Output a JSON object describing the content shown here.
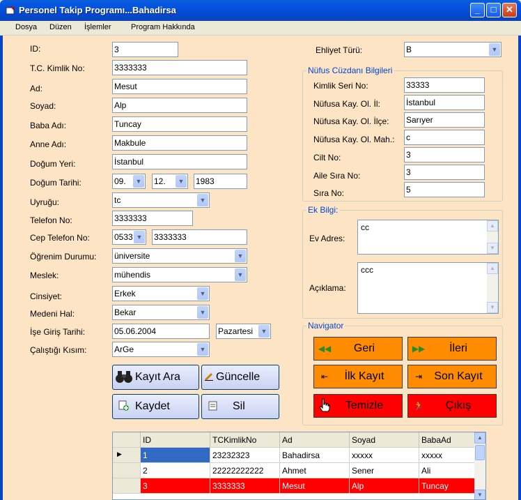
{
  "window": {
    "title": "Personel Takip Programı...Bahadirsa",
    "minimize": "_",
    "maximize": "□",
    "close": "✕"
  },
  "menu": [
    "Dosya",
    "Düzen",
    "İşlemler",
    "Program Hakkında"
  ],
  "form": {
    "id": {
      "label": "ID:",
      "value": "3"
    },
    "tc": {
      "label": "T.C. Kimlik No:",
      "value": "3333333"
    },
    "ad": {
      "label": "Ad:",
      "value": "Mesut"
    },
    "soyad": {
      "label": "Soyad:",
      "value": "Alp"
    },
    "baba": {
      "label": "Baba Adı:",
      "value": "Tuncay"
    },
    "anne": {
      "label": "Anne Adı:",
      "value": "Makbule"
    },
    "dogum_yeri": {
      "label": "Doğum Yeri:",
      "value": "İstanbul"
    },
    "dogum_tarihi": {
      "label": "Doğum Tarihi:",
      "day": "09.",
      "month": "12.",
      "year": "1983"
    },
    "uyruk": {
      "label": "Uyruğu:",
      "value": "tc"
    },
    "telefon": {
      "label": "Telefon No:",
      "value": "3333333"
    },
    "cep": {
      "label": "Cep Telefon No:",
      "prefix": "0533",
      "value": "3333333"
    },
    "ogrenim": {
      "label": "Öğrenim Durumu:",
      "value": "üniversite"
    },
    "meslek": {
      "label": "Meslek:",
      "value": "mühendis"
    },
    "cinsiyet": {
      "label": "Cinsiyet:",
      "value": "Erkek"
    },
    "medeni": {
      "label": "Medeni Hal:",
      "value": "Bekar"
    },
    "ise_giris": {
      "label": "İşe Giriş Tarihi:",
      "value": "05.06.2004",
      "weekday": "Pazartesi"
    },
    "kisim": {
      "label": "Çalıştığı Kısım:",
      "value": "ArGe"
    }
  },
  "ehliyet": {
    "label": "Ehliyet Türü:",
    "value": "B"
  },
  "nufus": {
    "title": "Nüfus Cüzdanı Bilgileri",
    "seri": {
      "label": "Kimlik Seri No:",
      "value": "33333"
    },
    "il": {
      "label": "Nüfusa Kay. Ol. İl:",
      "value": "İstanbul"
    },
    "ilce": {
      "label": "Nüfusa Kay. Ol. İlçe:",
      "value": "Sarıyer"
    },
    "mah": {
      "label": "Nüfusa Kay. Ol. Mah.:",
      "value": "c"
    },
    "cilt": {
      "label": "Cilt No:",
      "value": "3"
    },
    "aile": {
      "label": "Aile Sıra No:",
      "value": "3"
    },
    "sira": {
      "label": "Sıra No:",
      "value": "5"
    }
  },
  "ek": {
    "title": "Ek Bilgi:",
    "adres": {
      "label": "Ev Adres:",
      "value": "cc"
    },
    "aciklama": {
      "label": "Açıklama:",
      "value": "ccc"
    }
  },
  "actions": {
    "kayit_ara": "Kayıt Ara",
    "guncelle": "Güncelle",
    "kaydet": "Kaydet",
    "sil": "Sil"
  },
  "navigator": {
    "title": "Navigator",
    "geri": "Geri",
    "ileri": "İleri",
    "ilk": "İlk Kayıt",
    "son": "Son Kayıt",
    "temizle": "Temizle",
    "cikis": "Çıkış"
  },
  "grid": {
    "columns": [
      "ID",
      "TCKimlikNo",
      "Ad",
      "Soyad",
      "BabaAd"
    ],
    "rows": [
      [
        "1",
        "23232323",
        "Bahadirsa",
        "xxxxx",
        "xxxxx"
      ],
      [
        "2",
        "22222222222",
        "Ahmet",
        "Sener",
        "Ali"
      ],
      [
        "3",
        "3333333",
        "Mesut",
        "Alp",
        "Tuncay"
      ]
    ]
  },
  "colors": {
    "accent_blue": "#0046d5",
    "panel_bg": "#fce4c4",
    "nav_orange": "#ff8c00",
    "nav_red": "#ff0000",
    "selected_row": "#ff0000",
    "current_cell": "#316ac5"
  }
}
